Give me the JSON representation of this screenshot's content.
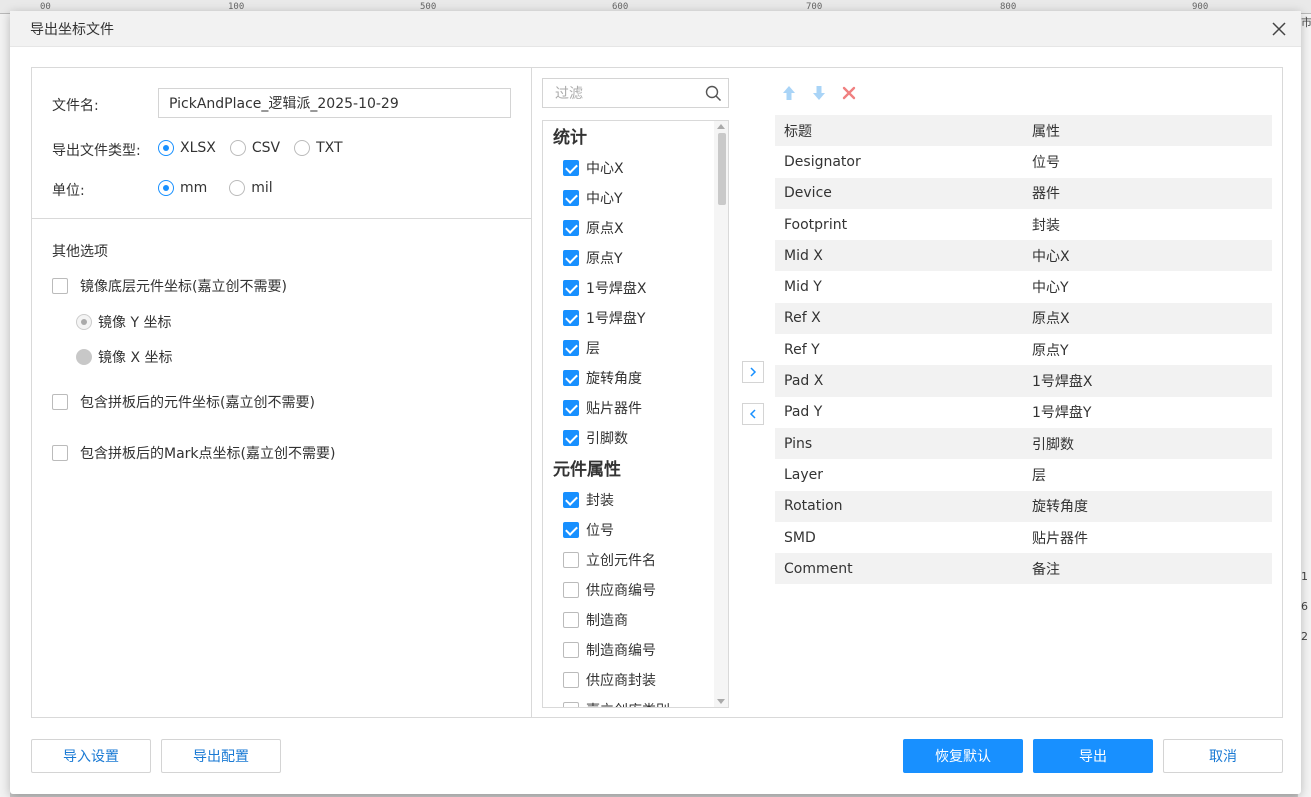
{
  "dialog": {
    "title": "导出坐标文件"
  },
  "form": {
    "filename_label": "文件名:",
    "filename_value": "PickAndPlace_逻辑派_2025-10-29",
    "filetype_label": "导出文件类型:",
    "filetype_options": [
      "XLSX",
      "CSV",
      "TXT"
    ],
    "filetype_selected": "XLSX",
    "unit_label": "单位:",
    "unit_options": [
      "mm",
      "mil"
    ],
    "unit_selected": "mm"
  },
  "other": {
    "title": "其他选项",
    "mirror_label": "镜像底层元件坐标(嘉立创不需要)",
    "mirror_y": "镜像 Y 坐标",
    "mirror_x": "镜像 X 坐标",
    "panel_label": "包含拼板后的元件坐标(嘉立创不需要)",
    "mark_label": "包含拼板后的Mark点坐标(嘉立创不需要)"
  },
  "filter": {
    "placeholder": "过滤"
  },
  "groups": [
    {
      "title": "统计",
      "items": [
        {
          "label": "中心X",
          "checked": true
        },
        {
          "label": "中心Y",
          "checked": true
        },
        {
          "label": "原点X",
          "checked": true
        },
        {
          "label": "原点Y",
          "checked": true
        },
        {
          "label": "1号焊盘X",
          "checked": true
        },
        {
          "label": "1号焊盘Y",
          "checked": true
        },
        {
          "label": "层",
          "checked": true
        },
        {
          "label": "旋转角度",
          "checked": true
        },
        {
          "label": "贴片器件",
          "checked": true
        },
        {
          "label": "引脚数",
          "checked": true
        }
      ]
    },
    {
      "title": "元件属性",
      "items": [
        {
          "label": "封装",
          "checked": true
        },
        {
          "label": "位号",
          "checked": true
        },
        {
          "label": "立创元件名",
          "checked": false
        },
        {
          "label": "供应商编号",
          "checked": false
        },
        {
          "label": "制造商",
          "checked": false
        },
        {
          "label": "制造商编号",
          "checked": false
        },
        {
          "label": "供应商封装",
          "checked": false
        },
        {
          "label": "嘉立创库类别",
          "checked": false
        }
      ]
    }
  ],
  "table": {
    "header": [
      "标题",
      "属性"
    ],
    "rows": [
      [
        "Designator",
        "位号"
      ],
      [
        "Device",
        "器件"
      ],
      [
        "Footprint",
        "封装"
      ],
      [
        "Mid X",
        "中心X"
      ],
      [
        "Mid Y",
        "中心Y"
      ],
      [
        "Ref X",
        "原点X"
      ],
      [
        "Ref Y",
        "原点Y"
      ],
      [
        "Pad X",
        "1号焊盘X"
      ],
      [
        "Pad Y",
        "1号焊盘Y"
      ],
      [
        "Pins",
        "引脚数"
      ],
      [
        "Layer",
        "层"
      ],
      [
        "Rotation",
        "旋转角度"
      ],
      [
        "SMD",
        "贴片器件"
      ],
      [
        "Comment",
        "备注"
      ]
    ]
  },
  "footer": {
    "import_settings": "导入设置",
    "export_config": "导出配置",
    "restore_default": "恢复默认",
    "export": "导出",
    "cancel": "取消"
  },
  "background": {
    "ruler_ticks": [
      "00",
      "100",
      "500",
      "600",
      "700",
      "800",
      "900"
    ],
    "right_marks": [
      "市",
      "1",
      "6",
      "2"
    ]
  },
  "colors": {
    "accent": "#1890ff",
    "delete": "#f08080",
    "arrow_disabled": "#a9d4f7"
  }
}
